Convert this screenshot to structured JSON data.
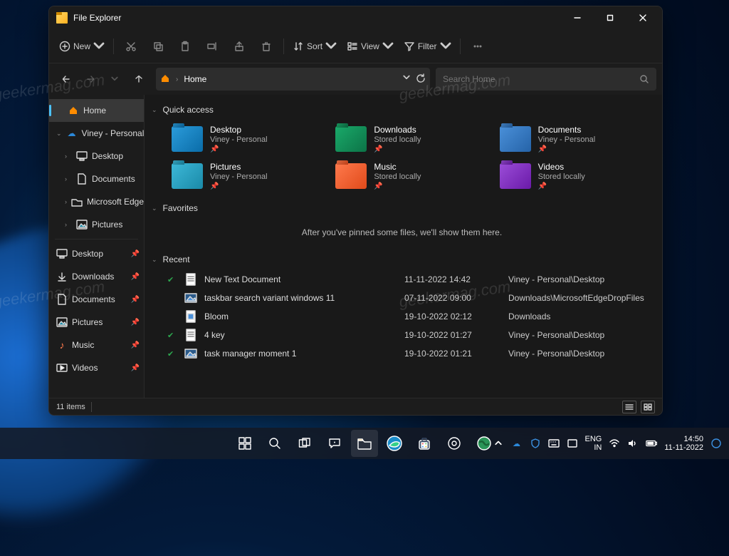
{
  "window": {
    "title": "File Explorer",
    "minimize": "−",
    "maximize": "□",
    "close": "✕"
  },
  "toolbar": {
    "new": "New",
    "sort": "Sort",
    "view": "View",
    "filter": "Filter"
  },
  "address": {
    "location": "Home",
    "search_placeholder": "Search Home"
  },
  "sidebar": {
    "home": "Home",
    "account": "Viney - Personal",
    "items_a": [
      {
        "label": "Desktop",
        "icon": "desktop"
      },
      {
        "label": "Documents",
        "icon": "doc"
      },
      {
        "label": "Microsoft Edge",
        "icon": "edge"
      },
      {
        "label": "Pictures",
        "icon": "pic"
      }
    ],
    "items_b": [
      {
        "label": "Desktop",
        "icon": "desktop"
      },
      {
        "label": "Downloads",
        "icon": "down"
      },
      {
        "label": "Documents",
        "icon": "doc"
      },
      {
        "label": "Pictures",
        "icon": "pic"
      },
      {
        "label": "Music",
        "icon": "music"
      },
      {
        "label": "Videos",
        "icon": "video"
      }
    ]
  },
  "sections": {
    "quick": "Quick access",
    "fav": "Favorites",
    "recent": "Recent"
  },
  "quick": [
    {
      "name": "Desktop",
      "sub": "Viney - Personal",
      "cls": "folder-blue",
      "cloud": false
    },
    {
      "name": "Downloads",
      "sub": "Stored locally",
      "cls": "folder-green",
      "cloud": false
    },
    {
      "name": "Documents",
      "sub": "Viney - Personal",
      "cls": "folder-blue2",
      "cloud": true
    },
    {
      "name": "Pictures",
      "sub": "Viney - Personal",
      "cls": "folder-cyan",
      "cloud": true
    },
    {
      "name": "Music",
      "sub": "Stored locally",
      "cls": "folder-orange",
      "cloud": false
    },
    {
      "name": "Videos",
      "sub": "Stored locally",
      "cls": "folder-purple",
      "cloud": false
    }
  ],
  "fav_empty": "After you've pinned some files, we'll show them here.",
  "recent": [
    {
      "sync": true,
      "name": "New Text Document",
      "date": "11-11-2022 14:42",
      "path": "Viney - Personal\\Desktop",
      "kind": "txt"
    },
    {
      "sync": false,
      "name": "taskbar search variant windows 11",
      "date": "07-11-2022 09:00",
      "path": "Downloads\\MicrosoftEdgeDropFiles",
      "kind": "img"
    },
    {
      "sync": false,
      "name": "Bloom",
      "date": "19-10-2022 02:12",
      "path": "Downloads",
      "kind": "img2"
    },
    {
      "sync": true,
      "name": "4 key",
      "date": "19-10-2022 01:27",
      "path": "Viney - Personal\\Desktop",
      "kind": "txt"
    },
    {
      "sync": true,
      "name": "task manager moment 1",
      "date": "19-10-2022 01:21",
      "path": "Viney - Personal\\Desktop",
      "kind": "img"
    }
  ],
  "status": {
    "items": "11 items"
  },
  "tray": {
    "lang1": "ENG",
    "lang2": "IN",
    "time": "14:50",
    "date": "11-11-2022"
  },
  "watermark": "geekermag.com"
}
